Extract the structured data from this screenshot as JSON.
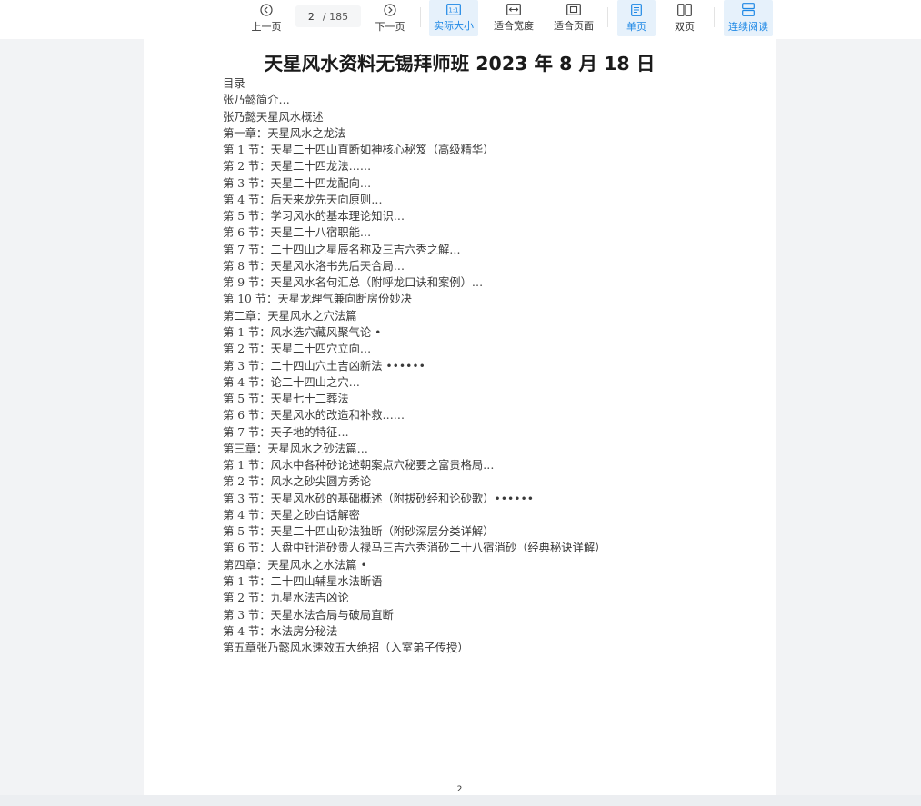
{
  "toolbar": {
    "prev_label": "上一页",
    "next_label": "下一页",
    "current_page": "2",
    "total_pages": "/ 185",
    "actual_size_label": "实际大小",
    "fit_width_label": "适合宽度",
    "fit_page_label": "适合页面",
    "single_page_label": "单页",
    "double_page_label": "双页",
    "continuous_label": "连续阅读",
    "accent_color": "#1e88e5"
  },
  "document": {
    "title": "天星风水资料无锡拜师班 2023 年 8 月 18 日",
    "toc": [
      "目录",
      "张乃懿简介…",
      "张乃懿天星风水概述",
      "第一章：天星风水之龙法",
      "第 1 节：天星二十四山直断如神核心秘笈（高级精华）",
      "第 2 节：天星二十四龙法……",
      "第 3 节：天星二十四龙配向…",
      "第 4 节：后天来龙先天向原则…",
      "第 5 节：学习风水的基本理论知识…",
      "第 6 节：天星二十八宿职能…",
      "第 7 节：二十四山之星辰名称及三吉六秀之解…",
      "第 8 节：天星风水洛书先后天合局…",
      "第 9 节：天星风水名句汇总（附呼龙口诀和案例）…",
      "第 10 节：天星龙理气兼向断房份妙决",
      "第二章：天星风水之穴法篇",
      "第 1 节：风水选穴藏风聚气论 •",
      "第 2 节：天星二十四穴立向…",
      "第 3 节：二十四山穴土吉凶新法 ••••••",
      "第 4 节：论二十四山之穴…",
      "第 5 节：天星七十二葬法",
      "第 6 节：天星风水的改造和补救……",
      "第 7 节：天子地的特征…",
      "第三章：天星风水之砂法篇…",
      "第 1 节：风水中各种砂论述朝案点穴秘要之富贵格局…",
      "第 2 节：风水之砂尖圆方秀论",
      "第 3 节：天星风水砂的基础概述（附拔砂经和论砂歌）••••••",
      "第 4 节：天星之砂白话解密",
      "第 5 节：天星二十四山砂法独断（附砂深层分类详解）",
      "第 6 节：人盘中针消砂贵人禄马三吉六秀消砂二十八宿消砂（经典秘诀详解）",
      "第四章：天星风水之水法篇 •",
      "第 1 节：二十四山辅星水法断语",
      "第 2 节：九星水法吉凶论",
      "第 3 节：天星水法合局与破局直断",
      "第 4 节：水法房分秘法",
      "第五章张乃懿风水速效五大绝招（入室弟子传授）"
    ],
    "page_number": "2"
  }
}
